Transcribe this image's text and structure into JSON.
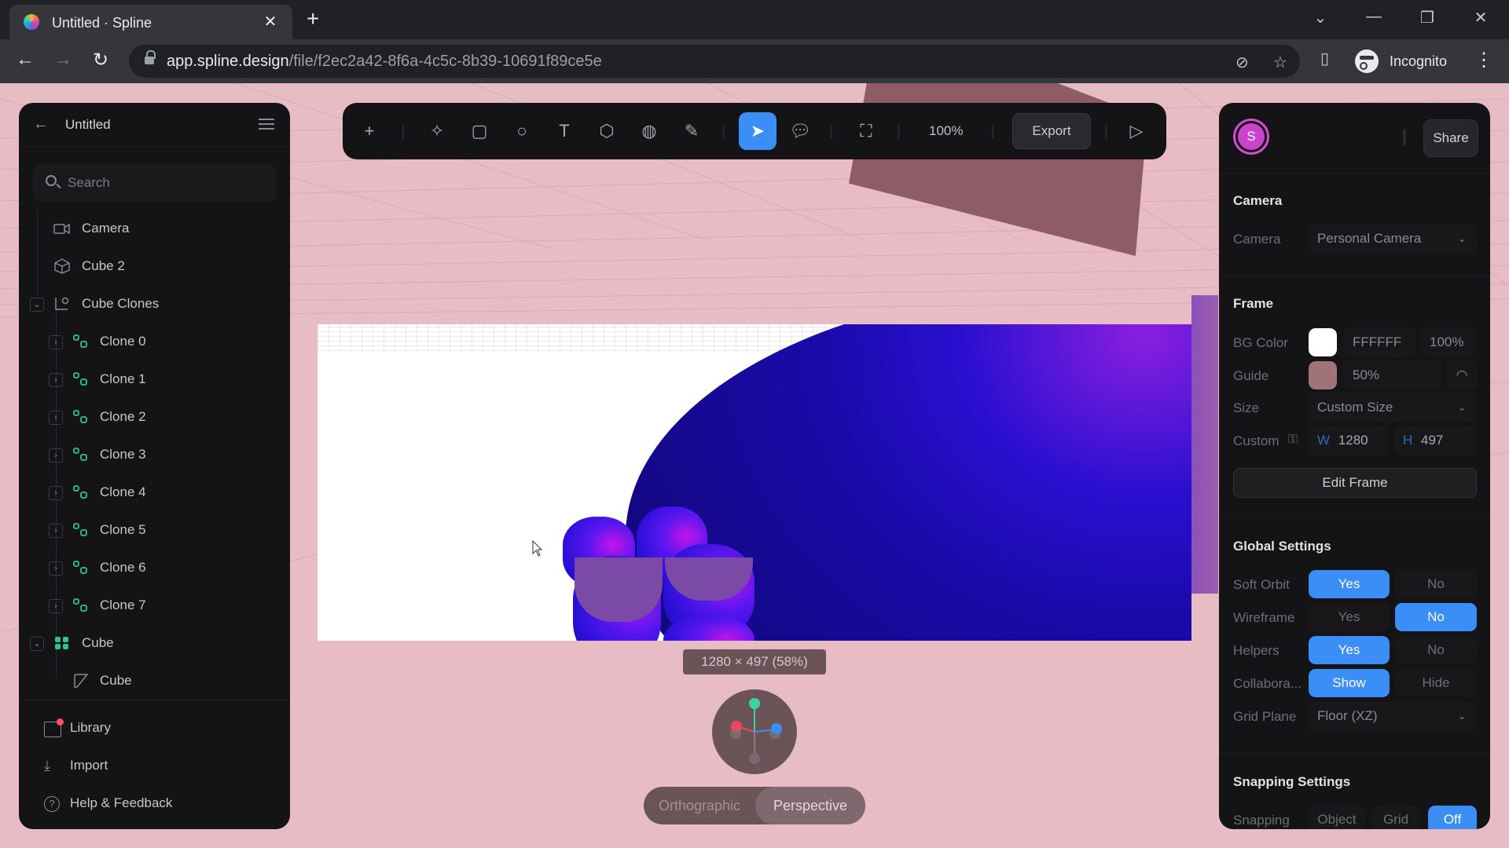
{
  "browser": {
    "tab_title": "Untitled · Spline",
    "url_host": "app.spline.design",
    "url_path": "/file/f2ec2a42-8f6a-4c5c-8b39-10691f89ce5e",
    "profile_label": "Incognito",
    "icons": [
      "back-icon",
      "forward-icon",
      "reload-icon",
      "lock-icon",
      "eye-off-icon",
      "star-icon",
      "sidebar-icon",
      "incognito-icon",
      "kebab-icon"
    ]
  },
  "left_panel": {
    "title": "Untitled",
    "search_placeholder": "Search",
    "tree": [
      {
        "label": "Camera",
        "icon": "camera-icon"
      },
      {
        "label": "Cube 2",
        "icon": "cube-icon"
      },
      {
        "label": "Cube Clones",
        "icon": "clone-group-icon",
        "expanded": true
      },
      {
        "label": "Clone 0",
        "icon": "clone-icon"
      },
      {
        "label": "Clone 1",
        "icon": "clone-icon"
      },
      {
        "label": "Clone 2",
        "icon": "clone-icon"
      },
      {
        "label": "Clone 3",
        "icon": "clone-icon"
      },
      {
        "label": "Clone 4",
        "icon": "clone-icon"
      },
      {
        "label": "Clone 5",
        "icon": "clone-icon"
      },
      {
        "label": "Clone 6",
        "icon": "clone-icon"
      },
      {
        "label": "Clone 7",
        "icon": "clone-icon"
      },
      {
        "label": "Cube",
        "icon": "component-icon",
        "expanded": true
      },
      {
        "label": "Cube",
        "icon": "shape-icon"
      }
    ],
    "footer": [
      {
        "label": "Library",
        "icon": "library-icon"
      },
      {
        "label": "Import",
        "icon": "import-icon"
      },
      {
        "label": "Help & Feedback",
        "icon": "help-icon"
      }
    ]
  },
  "toolbar": {
    "tools": [
      "add",
      "ai-sparkle",
      "rectangle",
      "ellipse",
      "text",
      "cube",
      "sphere",
      "pen",
      "select",
      "comment",
      "frame-fit"
    ],
    "active_tool": "select",
    "zoom": "100%",
    "export_label": "Export"
  },
  "right_panel": {
    "avatar_initial": "S",
    "share_label": "Share",
    "camera": {
      "heading": "Camera",
      "label": "Camera",
      "value": "Personal Camera"
    },
    "frame": {
      "heading": "Frame",
      "bg_color_label": "BG Color",
      "bg_color_hex": "FFFFFF",
      "bg_color_swatch": "#ffffff",
      "bg_opacity": "100%",
      "guide_label": "Guide",
      "guide_swatch": "#a0737b",
      "guide_value": "50%",
      "size_label": "Size",
      "size_value": "Custom Size",
      "custom_label": "Custom",
      "w_label": "W",
      "w_value": "1280",
      "h_label": "H",
      "h_value": "497",
      "edit_frame_label": "Edit Frame"
    },
    "global_settings": {
      "heading": "Global Settings",
      "rows": [
        {
          "label": "Soft Orbit",
          "options": [
            "Yes",
            "No"
          ],
          "selected": "Yes"
        },
        {
          "label": "Wireframe",
          "options": [
            "Yes",
            "No"
          ],
          "selected": "No"
        },
        {
          "label": "Helpers",
          "options": [
            "Yes",
            "No"
          ],
          "selected": "Yes"
        },
        {
          "label": "Collabora...",
          "options": [
            "Show",
            "Hide"
          ],
          "selected": "Show"
        }
      ],
      "grid_plane_label": "Grid Plane",
      "grid_plane_value": "Floor (XZ)"
    },
    "snapping": {
      "heading": "Snapping Settings",
      "label": "Snapping",
      "options": [
        "Object",
        "Grid",
        "Off"
      ],
      "selected": "Off"
    }
  },
  "viewport": {
    "size_badge": "1280 × 497 (58%)",
    "projection_options": [
      "Orthographic",
      "Perspective"
    ],
    "projection_selected": "Perspective",
    "accent_color": "#3a8ef6",
    "background_color": "#e8bcc4"
  }
}
